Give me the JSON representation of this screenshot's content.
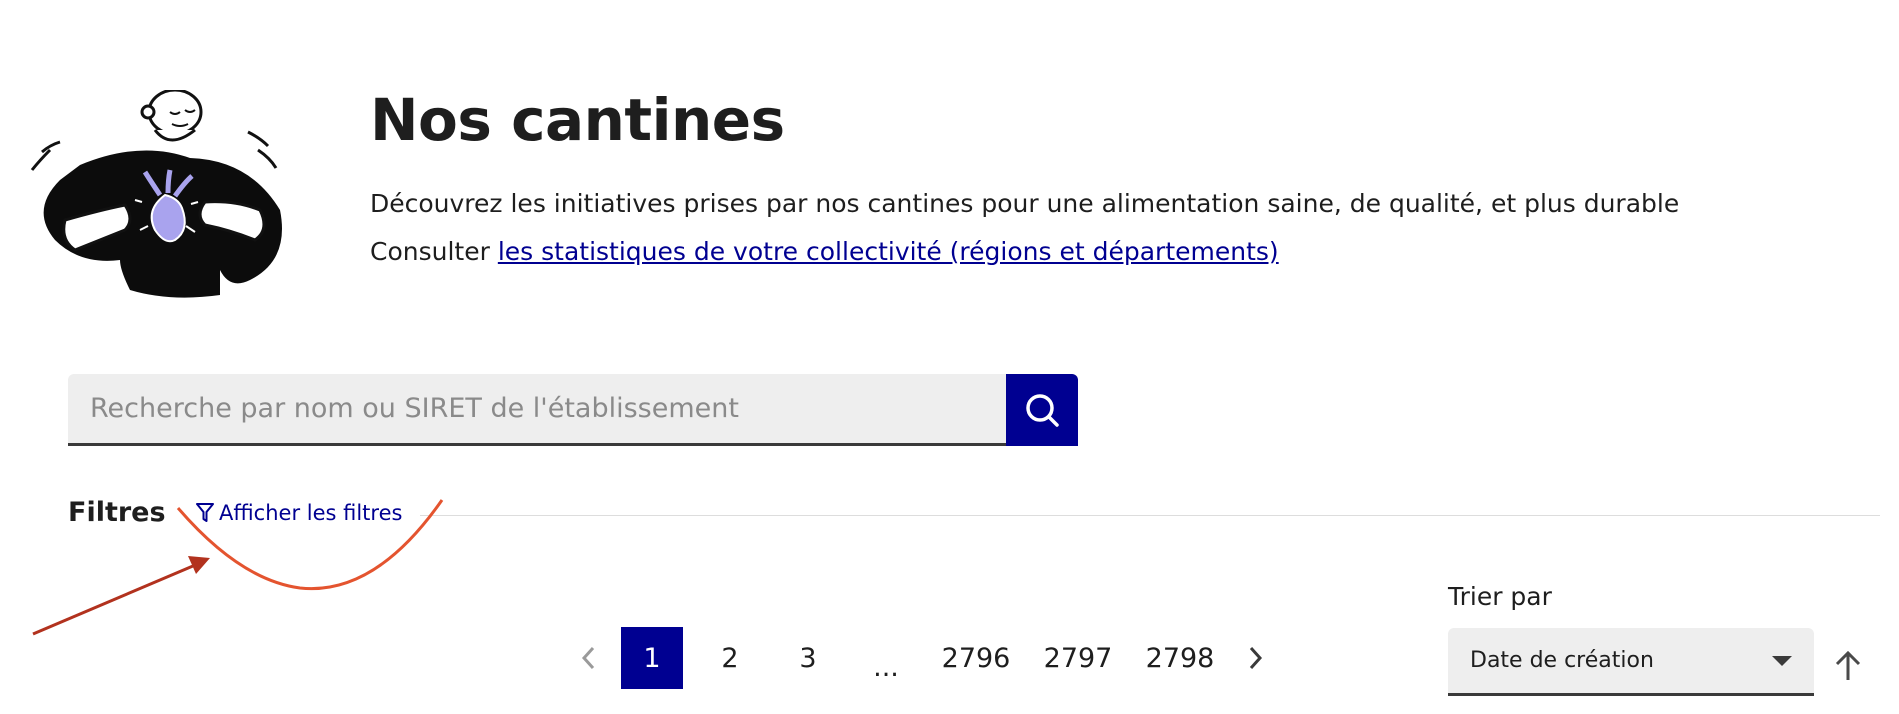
{
  "header": {
    "title": "Nos cantines",
    "description": "Découvrez les initiatives prises par nos cantines pour une alimentation saine, de qualité, et plus durable",
    "consult_prefix": "Consulter ",
    "stats_link": "les statistiques de votre collectivité (régions et départements)",
    "illustration_icon": "person-holding-beet-illustration"
  },
  "search": {
    "placeholder": "Recherche par nom ou SIRET de l'établissement",
    "value": "",
    "button_icon": "search-icon"
  },
  "filters": {
    "label": "Filtres",
    "toggle_label": "Afficher les filtres",
    "toggle_icon": "funnel-icon"
  },
  "pagination": {
    "current_page": 1,
    "pages": [
      "1",
      "2",
      "3"
    ],
    "ellipsis": "...",
    "last_pages": [
      "2796",
      "2797",
      "2798"
    ],
    "prev_icon": "chevron-left-icon",
    "next_icon": "chevron-right-icon"
  },
  "sort": {
    "label": "Trier par",
    "selected": "Date de création",
    "order_icon": "arrow-up-icon"
  },
  "colors": {
    "primary": "#000091",
    "annotation_arrow": "#b2321e",
    "annotation_curve": "#e4542f",
    "illustration_accent": "#a9a3ee"
  }
}
